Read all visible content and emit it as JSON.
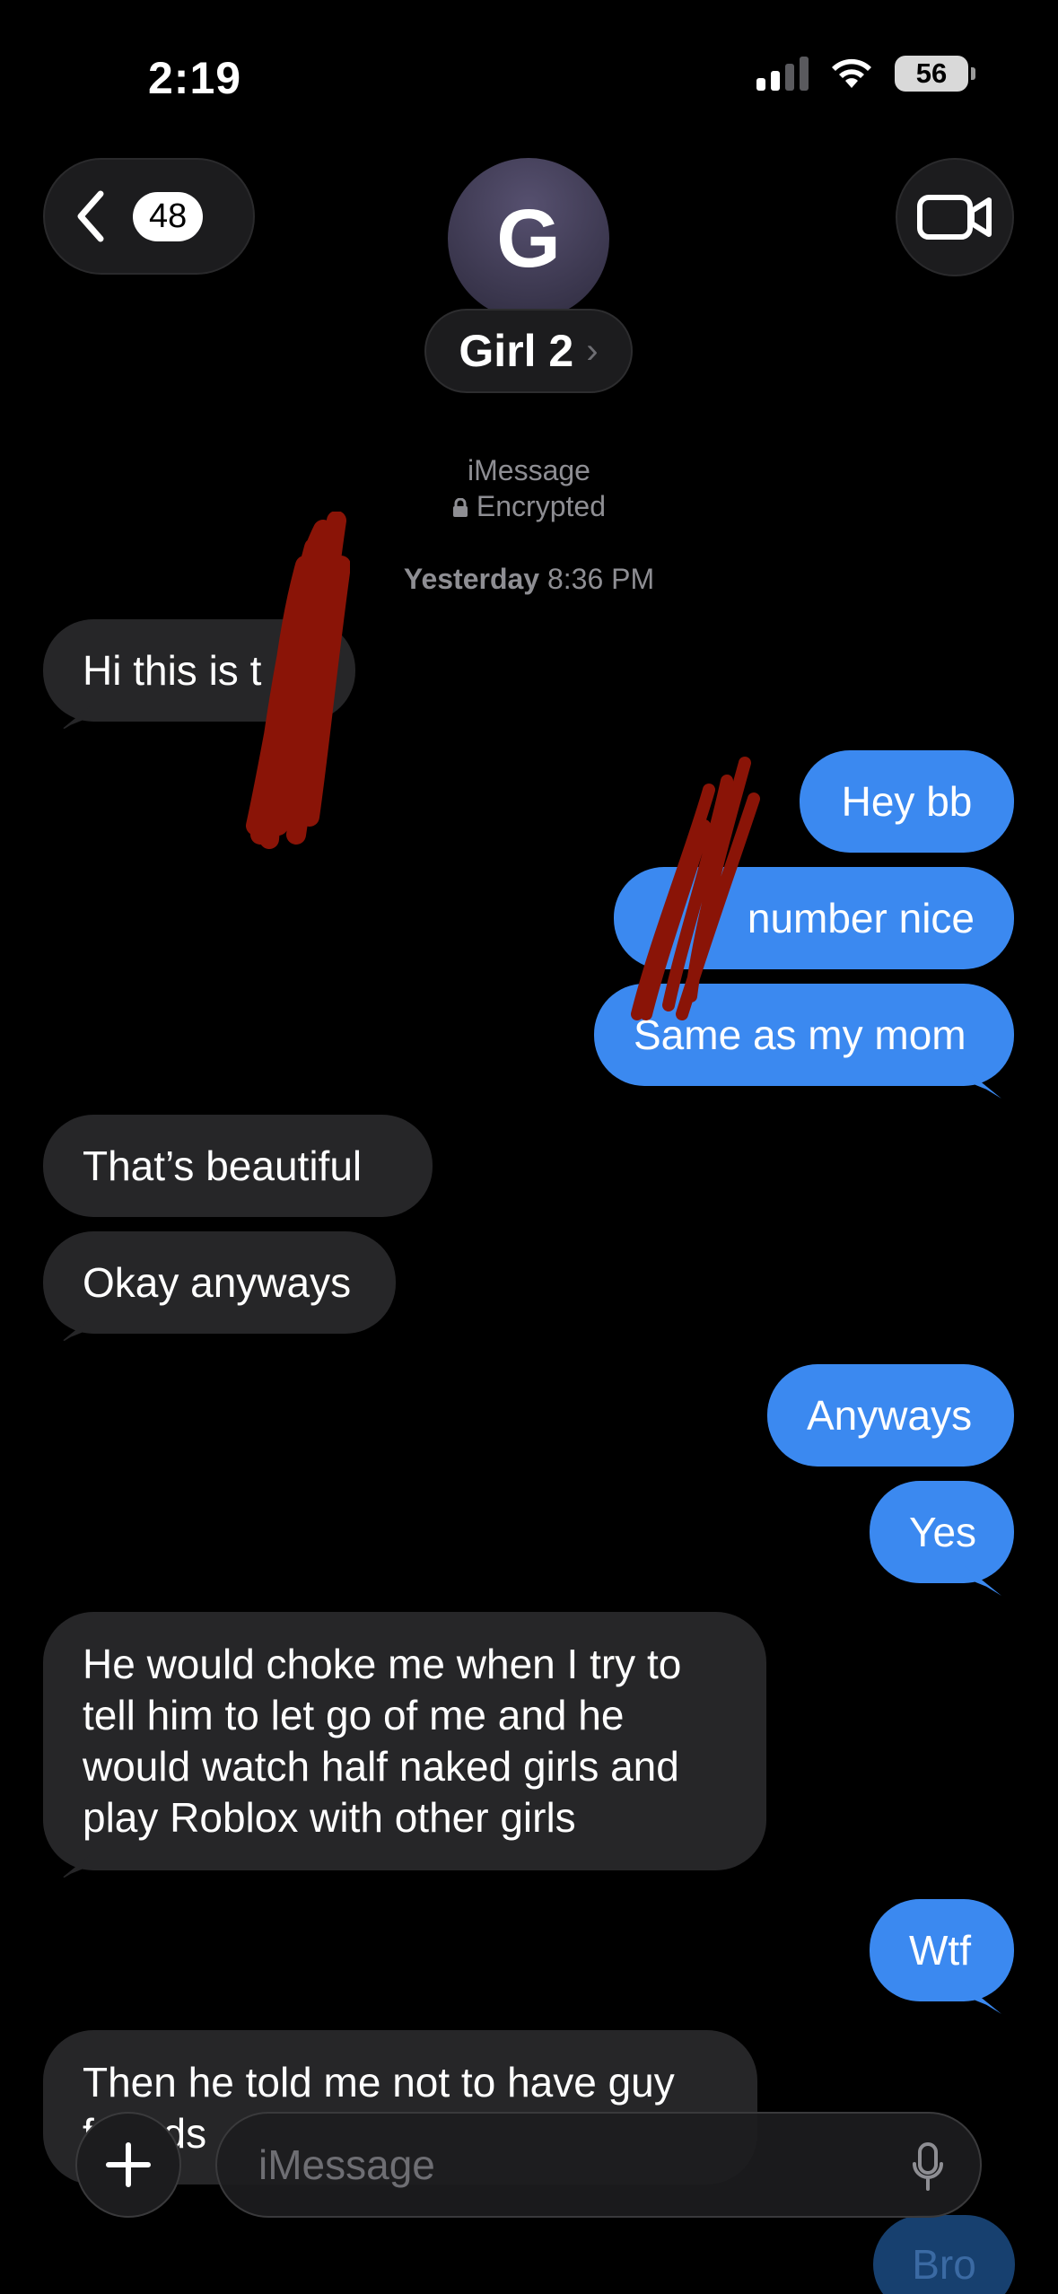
{
  "status_bar": {
    "time": "2:19",
    "battery": "56"
  },
  "header": {
    "back_count": "48",
    "avatar_initial": "G",
    "contact_name": "Girl 2",
    "chevron": "›"
  },
  "service": {
    "line1": "iMessage",
    "line2": "Encrypted"
  },
  "timestamp": {
    "day": "Yesterday",
    "time": "8:36 PM"
  },
  "messages": [
    {
      "dir": "in",
      "text": "Hi this is t"
    },
    {
      "dir": "out",
      "text": "Hey bb"
    },
    {
      "dir": "out",
      "text": "number nice"
    },
    {
      "dir": "out",
      "text": "Same as my mom"
    },
    {
      "dir": "in",
      "text": "That’s beautiful"
    },
    {
      "dir": "in",
      "text": "Okay anyways"
    },
    {
      "dir": "out",
      "text": "Anyways"
    },
    {
      "dir": "out",
      "text": "Yes"
    },
    {
      "dir": "in",
      "text": "He would choke me when I try to tell him to let go of me and he would watch half naked girls and play Roblox with other girls"
    },
    {
      "dir": "out",
      "text": "Wtf"
    },
    {
      "dir": "in",
      "text": "Then he told me not to have guy friends"
    },
    {
      "dir": "out",
      "text": "Bro"
    }
  ],
  "composer": {
    "placeholder": "iMessage"
  },
  "colors": {
    "outgoing": "#3b89f0",
    "incoming": "#262628",
    "redaction": "#8a1407"
  }
}
